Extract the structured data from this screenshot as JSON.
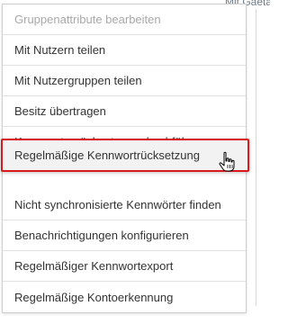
{
  "background": {
    "partial_text": "Mit Gaeta"
  },
  "menu": {
    "items": [
      {
        "label": "Gruppenattribute bearbeiten",
        "enabled": false
      },
      {
        "label": "Mit Nutzern teilen",
        "enabled": true
      },
      {
        "label": "Mit Nutzergruppen teilen",
        "enabled": true
      },
      {
        "label": "Besitz übertragen",
        "enabled": true
      },
      {
        "label": "Kennwortzurücksetzung durchführen",
        "enabled": true
      },
      {
        "label": "Regelmäßige Kennwortrücksetzung",
        "enabled": true,
        "highlighted": true
      },
      {
        "label": "Nicht synchronisierte Kennwörter finden",
        "enabled": true
      },
      {
        "label": "Benachrichtigungen konfigurieren",
        "enabled": true
      },
      {
        "label": "Regelmäßiger Kennwortexport",
        "enabled": true
      },
      {
        "label": "Regelmäßige Kontoerkennung",
        "enabled": true
      }
    ],
    "highlight_color": "#d9191c"
  },
  "cursor": {
    "icon": "hand-pointer-icon"
  }
}
